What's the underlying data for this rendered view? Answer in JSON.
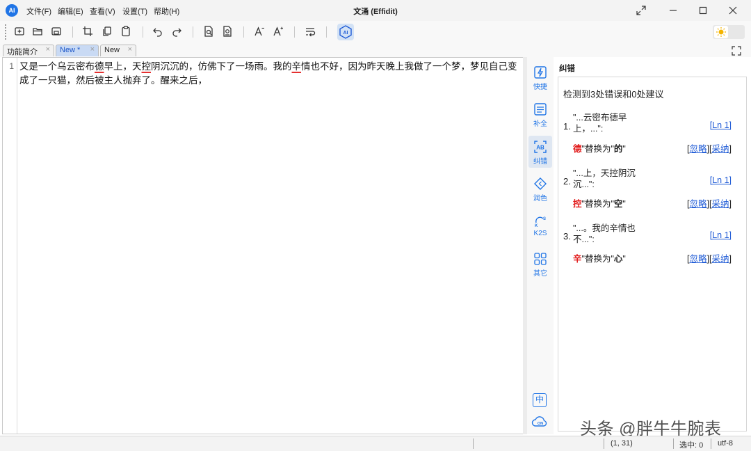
{
  "app": {
    "title": "文涌 (Effidit)",
    "logo_text": "AI"
  },
  "menu": [
    "文件(F)",
    "编辑(E)",
    "查看(V)",
    "设置(T)",
    "帮助(H)"
  ],
  "toolbar": {
    "icons": [
      "new-file-icon",
      "open-file-icon",
      "save-icon",
      "crop-icon",
      "copy-icon",
      "paste-icon",
      "undo-icon",
      "redo-icon",
      "find-icon",
      "replace-icon",
      "font-decrease-icon",
      "font-increase-icon",
      "wrap-icon",
      "ai-assist-icon"
    ],
    "ai_label": "AI"
  },
  "tabs": [
    {
      "label": "功能简介",
      "active": false
    },
    {
      "label": "New *",
      "active": true
    },
    {
      "label": "New",
      "active": false
    }
  ],
  "tab_close": "×",
  "editor": {
    "line_number": "1",
    "segments": [
      {
        "text": "又是一个乌云密布",
        "error": false
      },
      {
        "text": "德",
        "error": true
      },
      {
        "text": "早上，天",
        "error": false
      },
      {
        "text": "控",
        "error": true
      },
      {
        "text": "阴沉沉的，仿佛下了一场雨。我的",
        "error": false
      },
      {
        "text": "辛",
        "error": true
      },
      {
        "text": "情也不好，因为昨天晚上我做了一个梦，梦见自己变成了一只猫，然后被主人抛弃了。醒来之后，",
        "error": false
      }
    ]
  },
  "sidebar": [
    {
      "label": "快捷",
      "icon": "lightning-icon"
    },
    {
      "label": "补全",
      "icon": "complete-icon"
    },
    {
      "label": "纠错",
      "icon": "proofread-icon"
    },
    {
      "label": "润色",
      "icon": "polish-icon"
    },
    {
      "label": "K2S",
      "icon": "k2s-icon"
    },
    {
      "label": "其它",
      "icon": "grid-icon"
    }
  ],
  "zh_button": "中",
  "cloud_label": "ON",
  "panel": {
    "title": "纠错",
    "summary": "检测到3处错误和0处建议",
    "issues": [
      {
        "num": "1.",
        "snippet": "\"...云密布德早上，...\":",
        "ln": "[Ln 1]",
        "wrong": "德",
        "mid": "替换为",
        "right": "的",
        "ignore": "忽略",
        "accept": "采纳"
      },
      {
        "num": "2.",
        "snippet": "\"...上，天控阴沉沉...\":",
        "ln": "[Ln 1]",
        "wrong": "控",
        "mid": "替换为",
        "right": "空",
        "ignore": "忽略",
        "accept": "采纳"
      },
      {
        "num": "3.",
        "snippet": "\"...。我的辛情也不...\":",
        "ln": "[Ln 1]",
        "wrong": "辛",
        "mid": "替换为",
        "right": "心",
        "ignore": "忽略",
        "accept": "采纳"
      }
    ]
  },
  "status": {
    "position": "(1, 31)",
    "selection": "选中: 0",
    "encoding": "utf-8"
  },
  "watermark": "头条 @胖牛牛腕表"
}
